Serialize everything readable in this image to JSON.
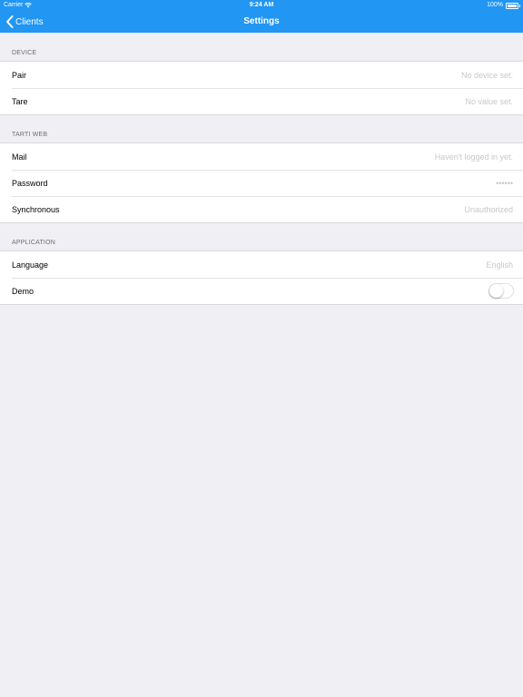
{
  "status_bar": {
    "carrier": "Carrier",
    "time": "9:24 AM",
    "battery": "100%",
    "wifi_icon": "wifi-icon",
    "battery_icon": "battery-icon"
  },
  "nav": {
    "back_label": "Clients",
    "back_icon": "chevron-left-icon",
    "title": "Settings",
    "bar_color": "#2196F3"
  },
  "sections": {
    "device": {
      "header": "DEVICE",
      "rows": [
        {
          "label": "Pair",
          "value": "No device set."
        },
        {
          "label": "Tare",
          "value": "No value set."
        }
      ]
    },
    "tarti_web": {
      "header": "TARTI WEB",
      "rows": [
        {
          "label": "Mail",
          "value": "Haven't logged in yet."
        },
        {
          "label": "Password",
          "value": "••••••"
        },
        {
          "label": "Synchronous",
          "value": "Unauthorized"
        }
      ]
    },
    "application": {
      "header": "APPLICATION",
      "rows": [
        {
          "label": "Language",
          "value": "English"
        },
        {
          "label": "Demo",
          "toggle_on": false
        }
      ]
    }
  }
}
